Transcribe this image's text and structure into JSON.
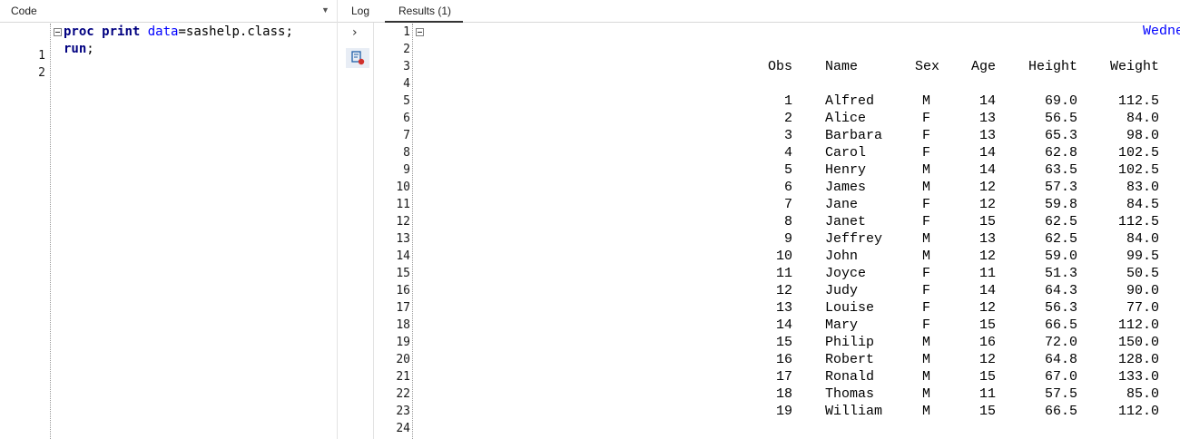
{
  "code_panel": {
    "title": "Code",
    "line_numbers": [
      "1",
      "2"
    ],
    "line1": {
      "kw1": "proc",
      "sp1": " ",
      "kw2": "print",
      "sp2": " ",
      "opt": "data",
      "rest": "=sashelp.class;"
    },
    "line2": {
      "kw": "run",
      "rest": ";"
    }
  },
  "tabs": {
    "log": "Log",
    "results": "Results (1)"
  },
  "toolbar": {
    "arrow": "›",
    "run_icon": "run-icon"
  },
  "results": {
    "header_date": "Wedne",
    "line_numbers": [
      "1",
      "2",
      "3",
      "4",
      "5",
      "6",
      "7",
      "8",
      "9",
      "10",
      "11",
      "12",
      "13",
      "14",
      "15",
      "16",
      "17",
      "18",
      "19",
      "20",
      "21",
      "22",
      "23",
      "24"
    ],
    "columns": [
      "Obs",
      "Name",
      "Sex",
      "Age",
      "Height",
      "Weight"
    ],
    "rows": [
      [
        "1",
        "Alfred",
        "M",
        "14",
        "69.0",
        "112.5"
      ],
      [
        "2",
        "Alice",
        "F",
        "13",
        "56.5",
        "84.0"
      ],
      [
        "3",
        "Barbara",
        "F",
        "13",
        "65.3",
        "98.0"
      ],
      [
        "4",
        "Carol",
        "F",
        "14",
        "62.8",
        "102.5"
      ],
      [
        "5",
        "Henry",
        "M",
        "14",
        "63.5",
        "102.5"
      ],
      [
        "6",
        "James",
        "M",
        "12",
        "57.3",
        "83.0"
      ],
      [
        "7",
        "Jane",
        "F",
        "12",
        "59.8",
        "84.5"
      ],
      [
        "8",
        "Janet",
        "F",
        "15",
        "62.5",
        "112.5"
      ],
      [
        "9",
        "Jeffrey",
        "M",
        "13",
        "62.5",
        "84.0"
      ],
      [
        "10",
        "John",
        "M",
        "12",
        "59.0",
        "99.5"
      ],
      [
        "11",
        "Joyce",
        "F",
        "11",
        "51.3",
        "50.5"
      ],
      [
        "12",
        "Judy",
        "F",
        "14",
        "64.3",
        "90.0"
      ],
      [
        "13",
        "Louise",
        "F",
        "12",
        "56.3",
        "77.0"
      ],
      [
        "14",
        "Mary",
        "F",
        "15",
        "66.5",
        "112.0"
      ],
      [
        "15",
        "Philip",
        "M",
        "16",
        "72.0",
        "150.0"
      ],
      [
        "16",
        "Robert",
        "M",
        "12",
        "64.8",
        "128.0"
      ],
      [
        "17",
        "Ronald",
        "M",
        "15",
        "67.0",
        "133.0"
      ],
      [
        "18",
        "Thomas",
        "M",
        "11",
        "57.5",
        "85.0"
      ],
      [
        "19",
        "William",
        "M",
        "15",
        "66.5",
        "112.0"
      ]
    ]
  }
}
